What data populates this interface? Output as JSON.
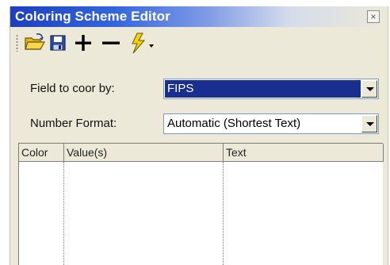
{
  "window": {
    "title": "Coloring Scheme Editor",
    "close_glyph": "×"
  },
  "toolbar": {
    "buttons": [
      {
        "name": "open",
        "icon": "open-folder-icon"
      },
      {
        "name": "save",
        "icon": "save-disk-icon"
      },
      {
        "name": "add",
        "icon": "plus-icon"
      },
      {
        "name": "remove",
        "icon": "minus-icon"
      },
      {
        "name": "auto",
        "icon": "lightning-icon",
        "has_dropdown": true
      }
    ]
  },
  "form": {
    "field_label": "Field to coor by:",
    "field_value": "FIPS",
    "format_label": "Number Format:",
    "format_value": "Automatic (Shortest Text)"
  },
  "grid": {
    "columns": [
      "Color",
      "Value(s)",
      "Text"
    ],
    "rows": []
  },
  "colors": {
    "title_gradient_start": "#1c3fc0",
    "panel_bg": "#ece9d8",
    "selection": "#1a2e8f",
    "lightning": "#f2d30a"
  }
}
